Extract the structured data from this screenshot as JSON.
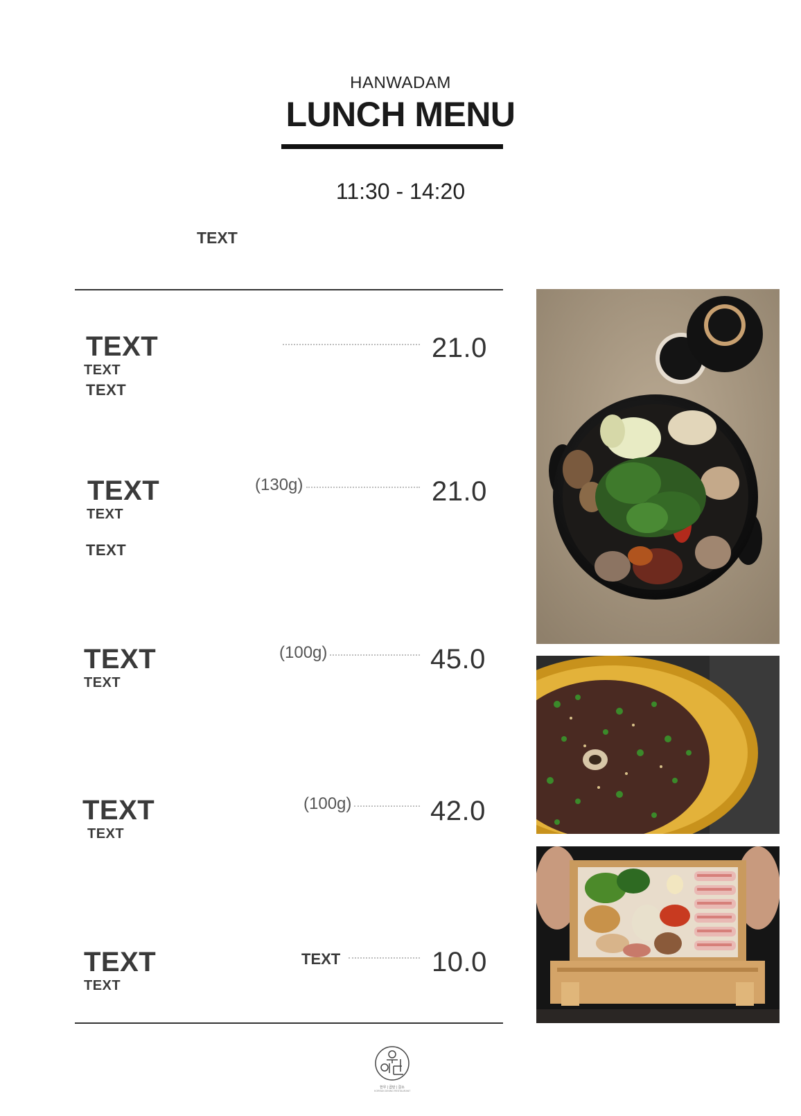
{
  "header": {
    "brand": "HANWADAM",
    "title": "LUNCH MENU",
    "hours": "11:30 - 14:20",
    "intro": "TEXT"
  },
  "items": [
    {
      "name": "TEXT",
      "sub1": "TEXT",
      "sub2": "TEXT",
      "weight": "",
      "price": "21.0"
    },
    {
      "name": "TEXT",
      "sub1": "TEXT",
      "sub2": "TEXT",
      "weight": "(130g)",
      "price": "21.0"
    },
    {
      "name": "TEXT",
      "sub1": "TEXT",
      "weight": "(100g)",
      "price": "45.0"
    },
    {
      "name": "TEXT",
      "sub1": "TEXT",
      "weight": "(100g)",
      "price": "42.0"
    },
    {
      "name": "TEXT",
      "sub1": "TEXT",
      "unit_label": "TEXT",
      "price": "10.0"
    }
  ],
  "photos": [
    {
      "icon": "hotpot-photo"
    },
    {
      "icon": "bulgogi-photo"
    },
    {
      "icon": "platter-photo"
    }
  ],
  "footer": {
    "logo_tagline": "한우 | 곱탄 | 갈소",
    "logo_subtitle": "KOREAN DINING RESTAURANT"
  },
  "colors": {
    "text": "#333333",
    "rule": "#333333",
    "dots": "#bdbdbd",
    "background": "#ffffff"
  }
}
